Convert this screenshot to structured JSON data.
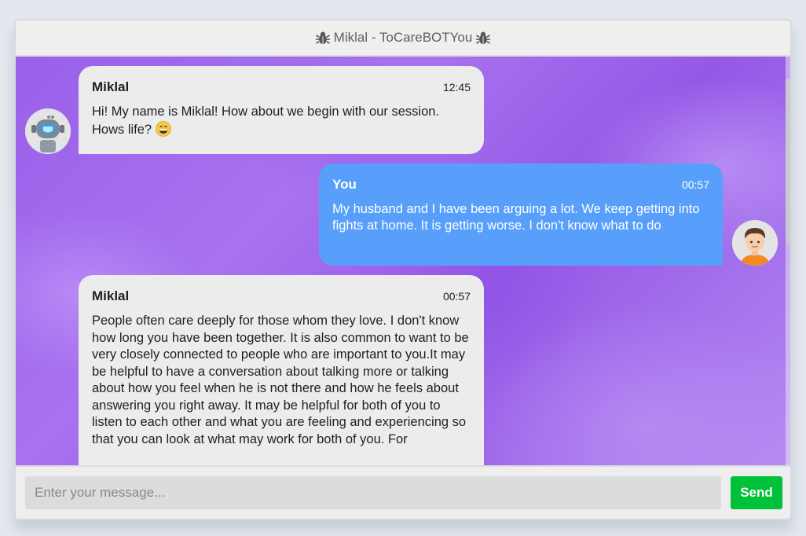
{
  "header": {
    "title": "Miklal - ToCareBOTYou",
    "icon": "bug-icon"
  },
  "messages": [
    {
      "sender": "Miklal",
      "time": "12:45",
      "text": "Hi! My name is Miklal! How about we begin with our session. Hows life?",
      "emoji": "grinning-face-emoji"
    },
    {
      "sender": "You",
      "time": "00:57",
      "text": "My husband and I have been arguing a lot. We keep getting into fights at home. It is getting worse. I don't know what to do"
    },
    {
      "sender": "Miklal",
      "time": "00:57",
      "text": "People often care deeply for those whom they love. I don't know how long you have been together. It is also common to want to be very closely connected to people who are important to you.It may be helpful to have a conversation about talking more or talking about how you feel when he is not there and how he feels about answering you right away. It may be helpful for both of you to listen to each other and what you are feeling and experiencing so that you can look at what may work for both of you. For"
    }
  ],
  "composer": {
    "placeholder": "Enter your message...",
    "send_label": "Send"
  },
  "colors": {
    "user_bubble": "#579ffb",
    "bot_bubble": "#ececec",
    "send_button": "#00c13a",
    "chat_background": "#9a60ea"
  }
}
